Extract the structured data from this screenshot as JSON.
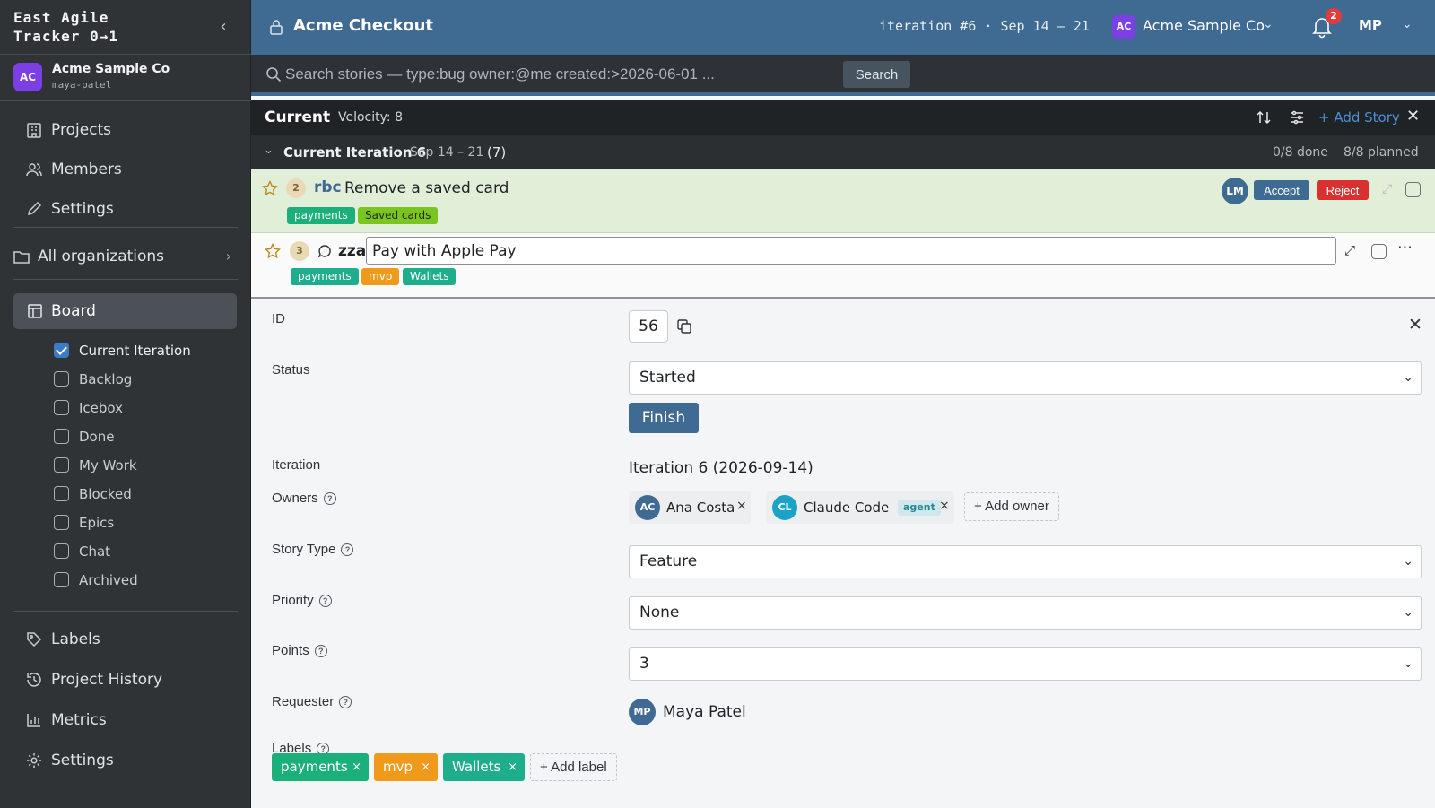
{
  "brand": {
    "line1": "East Agile",
    "line2": "Tracker 0→1"
  },
  "org": {
    "avatar": "AC",
    "name": "Acme Sample Co",
    "user": "maya-patel"
  },
  "sidebar": {
    "top_items": [
      {
        "label": "Projects",
        "icon": "building-icon"
      },
      {
        "label": "Members",
        "icon": "users-icon"
      },
      {
        "label": "Settings",
        "icon": "pencil-icon"
      }
    ],
    "all_orgs": "All organizations",
    "board": "Board",
    "board_items": [
      {
        "label": "Current Iteration",
        "checked": true
      },
      {
        "label": "Backlog",
        "checked": false
      },
      {
        "label": "Icebox",
        "checked": false
      },
      {
        "label": "Done",
        "checked": false
      },
      {
        "label": "My Work",
        "checked": false
      },
      {
        "label": "Blocked",
        "checked": false
      },
      {
        "label": "Epics",
        "checked": false
      },
      {
        "label": "Chat",
        "checked": false
      },
      {
        "label": "Archived",
        "checked": false
      }
    ],
    "bottom_items": [
      {
        "label": "Labels",
        "icon": "tag-icon"
      },
      {
        "label": "Project History",
        "icon": "history-icon"
      },
      {
        "label": "Metrics",
        "icon": "bar-chart-icon"
      },
      {
        "label": "Settings",
        "icon": "gear-icon"
      }
    ]
  },
  "topbar": {
    "title": "Acme Checkout",
    "iteration": "iteration #6 · Sep 14 – 21",
    "org_avatar": "AC",
    "org_name": "Acme Sample Co",
    "notifications": "2",
    "user": "MP"
  },
  "search": {
    "placeholder": "Search stories — type:bug owner:@me created:>2026-06-01 ...",
    "button": "Search"
  },
  "panel": {
    "title": "Current",
    "velocity": "Velocity: 8",
    "add_story": "+ Add Story",
    "iteration_title": "Current Iteration 6",
    "iteration_dates": "Sep 14 – 21",
    "iteration_count": "(7)",
    "done": "0/8 done",
    "planned": "8/8 planned"
  },
  "stories": [
    {
      "points": "2",
      "abbr": "rbc",
      "title": "Remove a saved card",
      "labels": [
        "payments",
        "Saved cards"
      ],
      "owner": "LM",
      "accept": "Accept",
      "reject": "Reject"
    },
    {
      "points": "3",
      "abbr": "zza",
      "title": "Pay with Apple Pay",
      "labels": [
        "payments",
        "mvp",
        "Wallets"
      ]
    }
  ],
  "detail": {
    "id_label": "ID",
    "id_value": "56",
    "status_label": "Status",
    "status_value": "Started",
    "finish_button": "Finish",
    "iteration_label": "Iteration",
    "iteration_value": "Iteration 6 (2026-09-14)",
    "owners_label": "Owners",
    "owners": [
      {
        "initials": "AC",
        "name": "Ana Costa"
      },
      {
        "initials": "CL",
        "name": "Claude Code",
        "tag": "agent"
      }
    ],
    "add_owner": "+ Add owner",
    "story_type_label": "Story Type",
    "story_type_value": "Feature",
    "priority_label": "Priority",
    "priority_value": "None",
    "points_label": "Points",
    "points_value": "3",
    "requester_label": "Requester",
    "requester_initials": "MP",
    "requester_name": "Maya Patel",
    "labels_label": "Labels",
    "labels": [
      "payments",
      "mvp",
      "Wallets"
    ],
    "add_label": "+ Add label"
  },
  "colors": {
    "topbar": "#3f6a91",
    "sidebar": "#2f3335",
    "accepted_row": "#e1efd9",
    "accent": "#4c8fd6",
    "reject": "#d93030"
  }
}
